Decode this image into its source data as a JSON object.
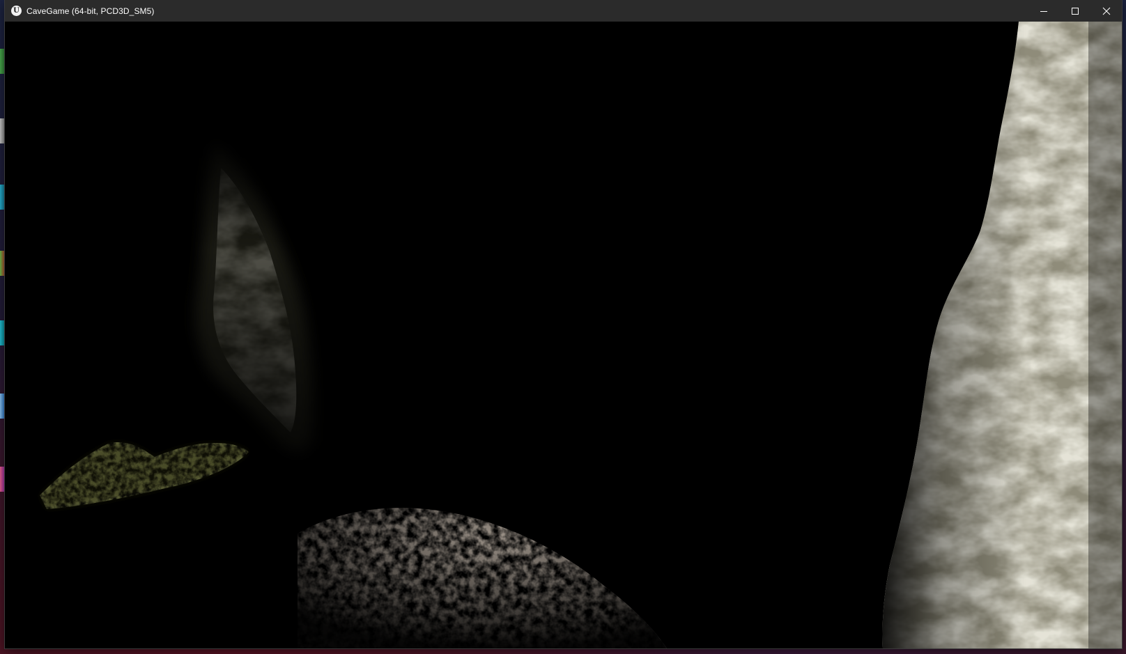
{
  "window": {
    "title": "CaveGame (64-bit, PCD3D_SM5)",
    "app_icon_glyph": "U",
    "app_icon_name": "unreal-engine-icon",
    "controls": {
      "minimize_icon": "minimize-icon",
      "maximize_icon": "maximize-icon",
      "close_icon": "close-icon"
    }
  },
  "scene": {
    "background_color": "#000000",
    "rock_color": "#c9c6b0",
    "moss_color": "#9aa53a",
    "boulder_color": "#4a4238"
  }
}
